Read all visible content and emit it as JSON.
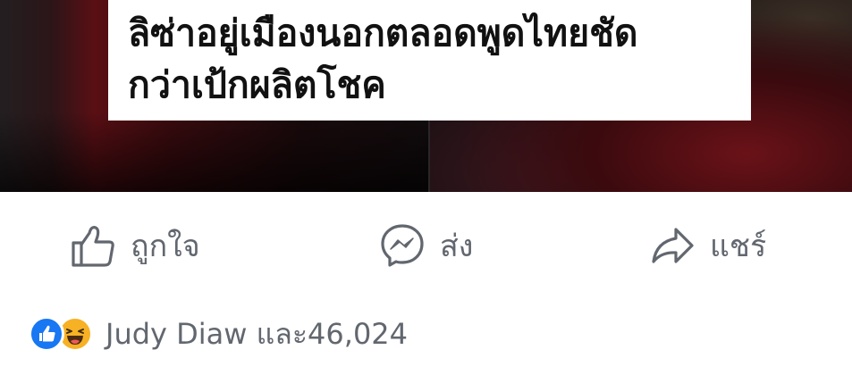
{
  "post": {
    "caption_lines": [
      "ลิซ่าอยู่เมืองนอกตลอดพูดไทยชัด",
      "กว่าเป้กผลิตโชค"
    ]
  },
  "actions": {
    "like": {
      "label": "ถูกใจ",
      "icon": "thumbs-up-icon"
    },
    "send": {
      "label": "ส่ง",
      "icon": "messenger-icon"
    },
    "share": {
      "label": "แชร์",
      "icon": "share-arrow-icon"
    }
  },
  "reactions": {
    "icons": [
      "like-reaction-icon",
      "haha-reaction-icon"
    ],
    "summary": "Judy Diaw และ46,024"
  },
  "colors": {
    "action_gray": "#62676f",
    "like_blue": "#1877f2",
    "haha_yellow": "#f7b125"
  }
}
